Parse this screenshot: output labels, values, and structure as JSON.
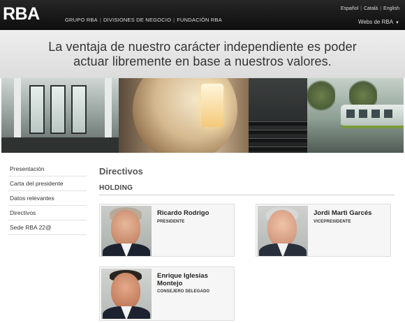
{
  "header": {
    "logo": "RBA",
    "nav": [
      "GRUPO RBA",
      "DIVISIONES DE NEGOCIO",
      "FUNDACIÓN RBA"
    ],
    "languages": [
      "Español",
      "Català",
      "English"
    ],
    "webs_label": "Webs de RBA",
    "webs_caret": "▼"
  },
  "tagline": {
    "line1": "La ventaja de nuestro carácter independiente es poder",
    "line2": "actuar libremente en base a nuestros valores."
  },
  "sidebar": {
    "items": [
      {
        "label": "Presentación"
      },
      {
        "label": "Carta del presidente"
      },
      {
        "label": "Datos relevantes"
      },
      {
        "label": "Directivos"
      },
      {
        "label": "Sede RBA 22@"
      }
    ]
  },
  "main": {
    "title": "Directivos",
    "section": "HOLDING",
    "people": [
      {
        "name": "Ricardo Rodrigo",
        "role": "PRESIDENTE"
      },
      {
        "name": "Jordi Marti Garcés",
        "role": "VICEPRESIDENTE"
      },
      {
        "name": "Enrique Iglesias Montejo",
        "role": "CONSEJERO DELEGADO"
      }
    ]
  },
  "colors": {
    "topbar": "#1a1a1a",
    "tagline_bg": "#e6e6e6",
    "card_bg": "#f6f6f6"
  }
}
